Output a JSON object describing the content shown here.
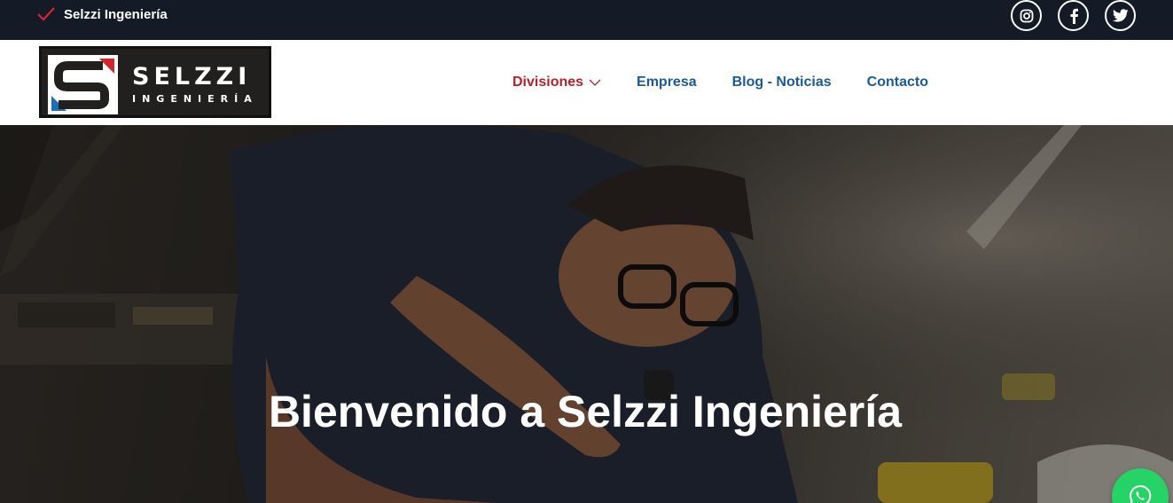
{
  "topbar": {
    "brand_text": "Selzzi Ingeniería",
    "social": [
      {
        "icon": "instagram-icon"
      },
      {
        "icon": "facebook-icon"
      },
      {
        "icon": "twitter-icon"
      }
    ]
  },
  "logo": {
    "line1": "SELZZI",
    "line2": "INGENIERÍA"
  },
  "nav": {
    "items": [
      {
        "label": "Divisiones",
        "has_dropdown": true,
        "active": true
      },
      {
        "label": "Empresa"
      },
      {
        "label": "Blog - Noticias"
      },
      {
        "label": "Contacto"
      }
    ]
  },
  "hero": {
    "title": "Bienvenido a Selzzi Ingeniería"
  },
  "colors": {
    "topbar_bg": "#151b26",
    "nav_link": "#1a5a95",
    "nav_active": "#b5222a",
    "whatsapp": "#25d366",
    "logo_red": "#d22630",
    "logo_blue": "#1f6fb8"
  }
}
